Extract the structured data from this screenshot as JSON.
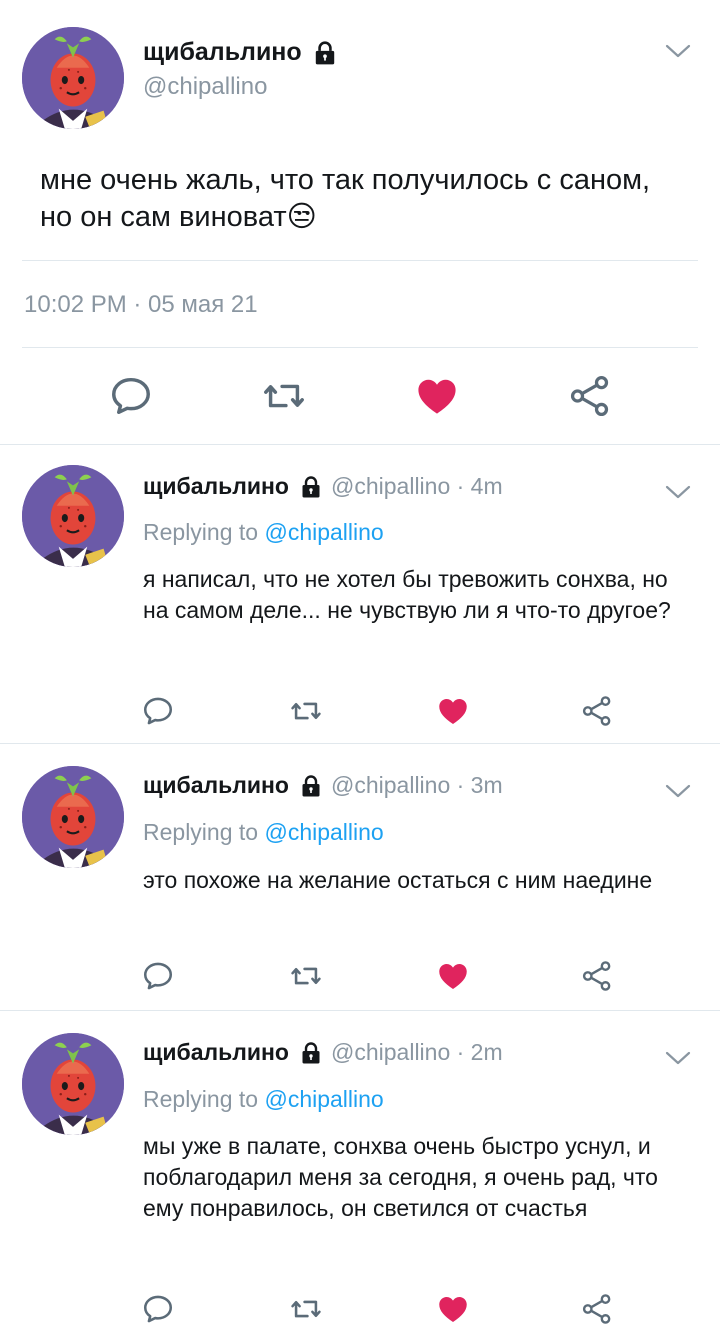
{
  "main_tweet": {
    "display_name": "щибальлино",
    "handle": "@chipallino",
    "text": "мне очень жаль, что так получилось с саном, но он сам виноват",
    "emoji": "😒",
    "timestamp": "10:02 PM · 05 мая 21"
  },
  "replies": [
    {
      "display_name": "щибальлино",
      "handle_time": "@chipallino · 4m",
      "replying_prefix": "Replying to ",
      "replying_to": "@chipallino",
      "text": "я написал, что не хотел бы тревожить сонхва, но на самом деле... не чувствую ли я что-то другое?"
    },
    {
      "display_name": "щибальлино",
      "handle_time": "@chipallino · 3m",
      "replying_prefix": "Replying to ",
      "replying_to": "@chipallino",
      "text": "это похоже на желание остаться с ним наедине"
    },
    {
      "display_name": "щибальлино",
      "handle_time": "@chipallino · 2m",
      "replying_prefix": "Replying to ",
      "replying_to": "@chipallino",
      "text": "мы уже в палате, сонхва очень быстро уснул, и поблагодарил меня за сегодня, я очень рад, что ему понравилось, он светился от счастья"
    }
  ],
  "icons": {
    "reply": "reply-icon",
    "retweet": "retweet-icon",
    "like": "like-icon",
    "share": "share-icon",
    "lock": "lock-icon",
    "caret": "chevron-down-icon"
  },
  "colors": {
    "like": "#e0245e",
    "link": "#1da1f2",
    "muted": "#8a96a1",
    "avatar_bg": "#6b5aa8",
    "divider": "#e1e8ed"
  }
}
